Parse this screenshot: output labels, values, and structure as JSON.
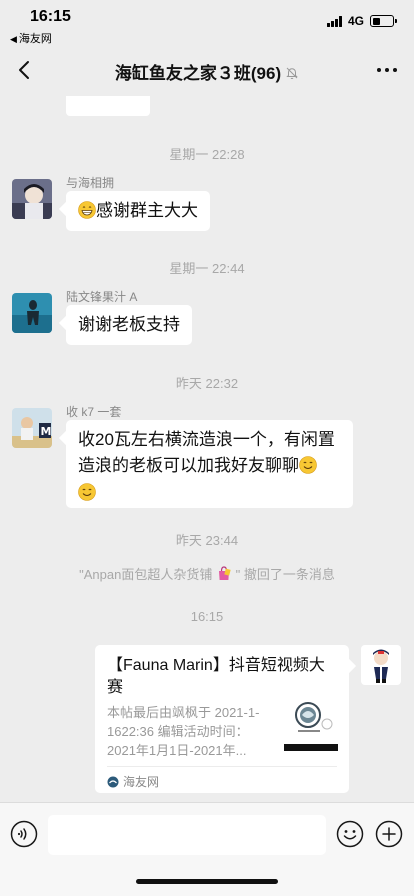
{
  "status_bar": {
    "time": "16:15",
    "back_app": "海友网",
    "network": "4G"
  },
  "nav": {
    "title": "海缸鱼友之家３班(96)",
    "icons": [
      "back-chevron-icon",
      "mute-bell-icon",
      "more-dots-icon"
    ]
  },
  "messages": [
    {
      "type": "time",
      "text": "星期一 22:28"
    },
    {
      "type": "text",
      "sender": "与海相拥",
      "emoji": "grin-emoji",
      "text": "感谢群主大大"
    },
    {
      "type": "time",
      "text": "星期一 22:44"
    },
    {
      "type": "text",
      "sender": "陆文锋果汁 A",
      "text": "谢谢老板支持"
    },
    {
      "type": "time",
      "text": "昨天 22:32"
    },
    {
      "type": "text",
      "sender": "收 k7 一套",
      "text": "收20瓦左右横流造浪一个，有闲置造浪的老板可以加我好友聊聊",
      "emoji": "smile-emoji"
    },
    {
      "type": "time",
      "text": "昨天 23:44"
    },
    {
      "type": "system",
      "quote_open": "\"",
      "name": "Anpan面包超人杂货铺",
      "emoji": "shopping-bag-emoji",
      "rest": "\" 撤回了一条消息"
    },
    {
      "type": "time",
      "text": "16:15"
    },
    {
      "type": "link",
      "from_self": true,
      "title": "【Fauna Marin】抖音短视频大赛",
      "description": "本帖最后由飒枫于 2021-1-1622:36 编辑活动时间：2021年1月1日-2021年...",
      "source": "海友网"
    }
  ],
  "input_bar": {
    "icons": [
      "voice-icon",
      "emoji-icon",
      "plus-icon"
    ]
  },
  "colors": {
    "background": "#ededed",
    "bubble": "#ffffff",
    "meta_text": "#a8a8a8"
  }
}
